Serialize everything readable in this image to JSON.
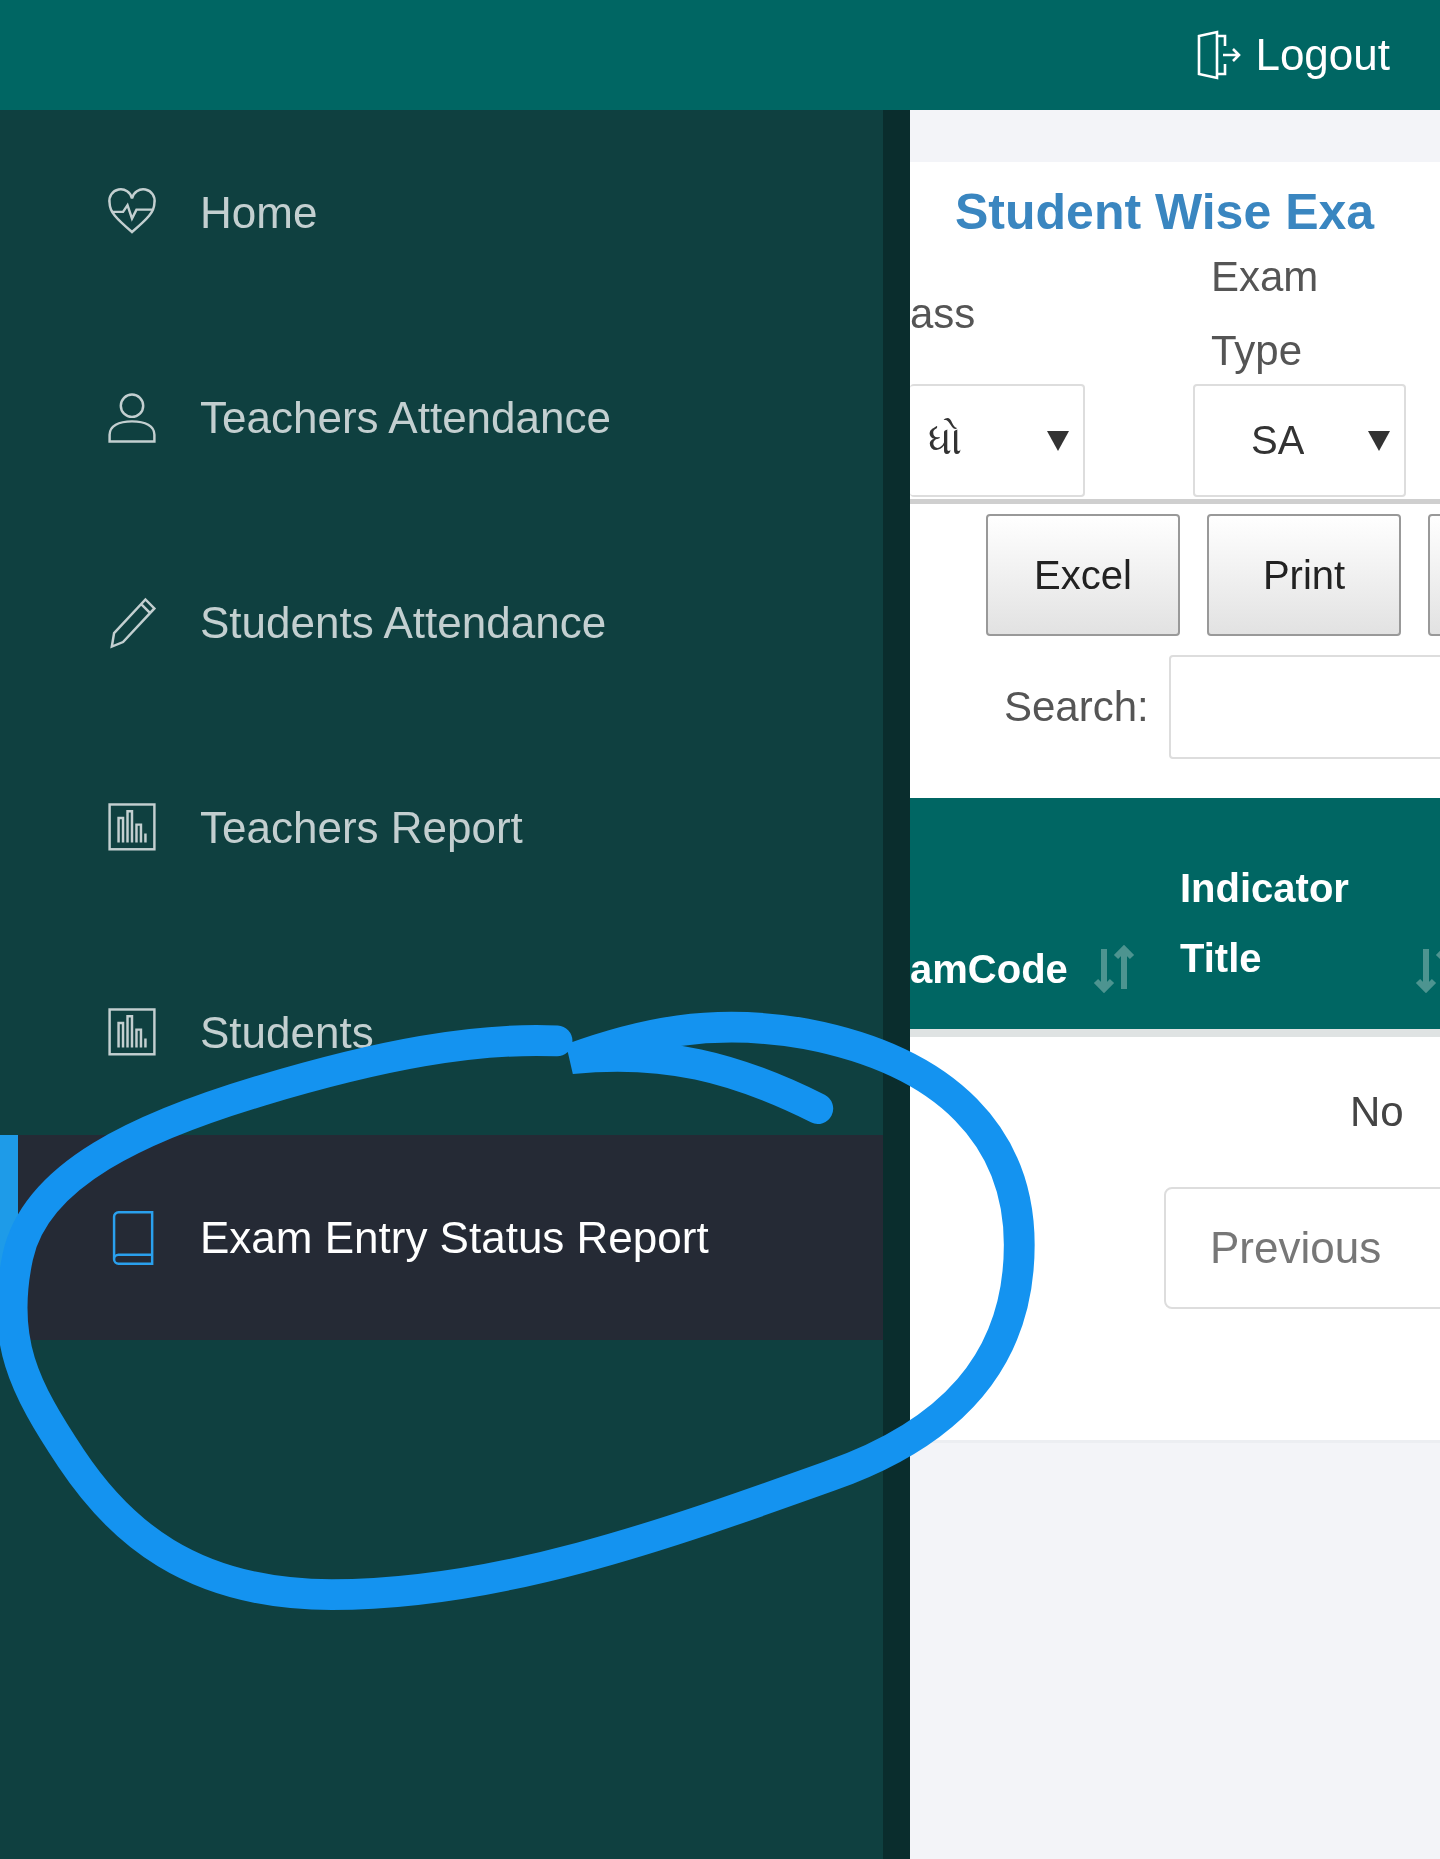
{
  "top_bar": {
    "logout": {
      "label": "Logout"
    }
  },
  "sidebar": {
    "items": [
      {
        "label": "Home",
        "selected": false
      },
      {
        "label": "Teachers Attendance",
        "selected": false
      },
      {
        "label": "Students Attendance",
        "selected": false
      },
      {
        "label": "Teachers Report",
        "selected": false
      },
      {
        "label": "Students",
        "selected": false
      },
      {
        "label": "Exam Entry Status Report",
        "selected": true
      }
    ]
  },
  "content": {
    "title": "Student Wise Exa",
    "filters": [
      {
        "label": "ass",
        "value": "ધો"
      },
      {
        "label": "Exam Type",
        "value": "SA"
      }
    ],
    "buttons": [
      "Excel",
      "Print"
    ],
    "search": {
      "label": "Search:"
    },
    "table": {
      "columns": [
        {
          "label": "amCode"
        },
        {
          "label": "Indicator Title"
        }
      ],
      "empty_message": "No"
    },
    "pagination": {
      "previous": "Previous"
    }
  }
}
